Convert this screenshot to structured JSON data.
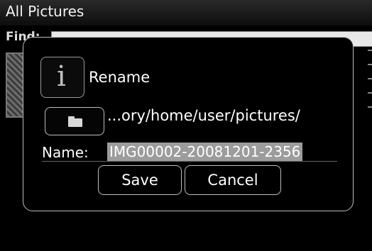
{
  "window": {
    "title": "All Pictures"
  },
  "find": {
    "label": "Find:"
  },
  "dialog": {
    "title": "Rename",
    "info_icon": "info-icon",
    "folder_icon": "folder-icon",
    "path": "...ory/home/user/pictures/",
    "name_label": "Name:",
    "name_value": "IMG00002-20081201-2356",
    "save_label": "Save",
    "cancel_label": "Cancel"
  },
  "colors": {
    "background": "#000000",
    "border": "#bdbdbd",
    "selection": "#9c9c9c",
    "text": "#ffffff"
  }
}
